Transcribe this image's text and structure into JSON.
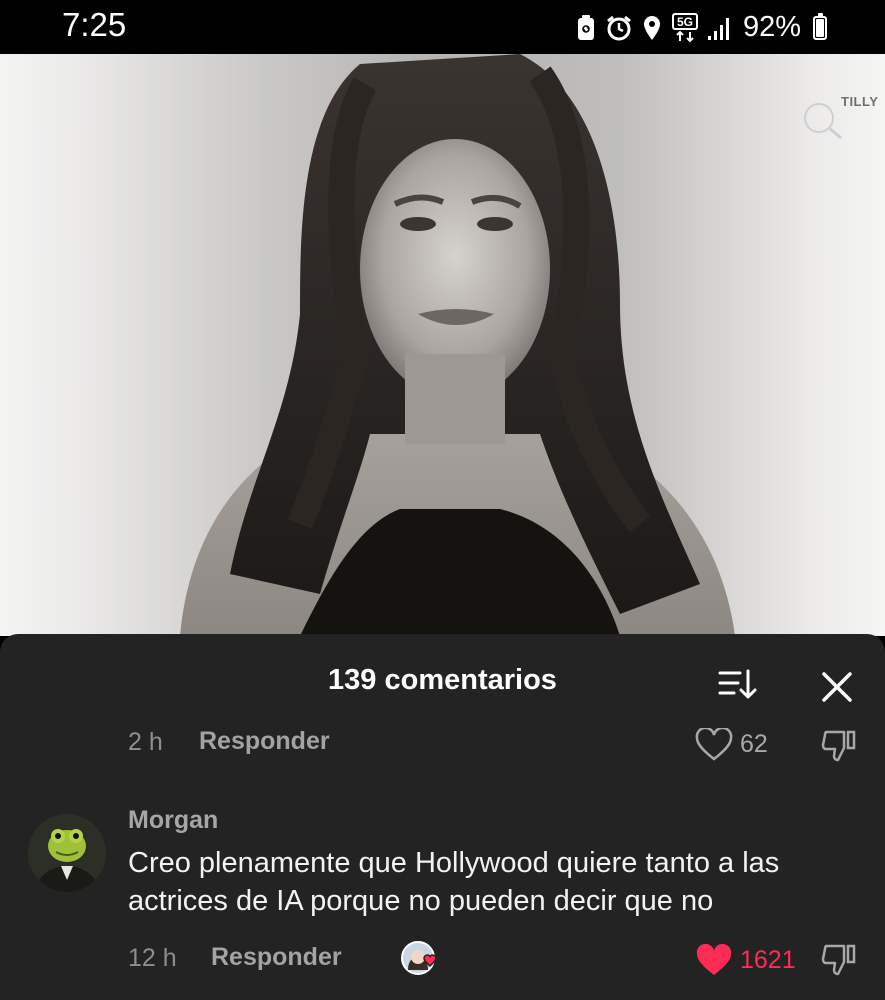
{
  "status_bar": {
    "time": "7:25",
    "network": "5G",
    "battery_percent": "92%",
    "icons": [
      "battery-saver-icon",
      "alarm-icon",
      "location-icon",
      "5g-data-icon",
      "signal-icon",
      "battery-icon"
    ]
  },
  "video": {
    "watermark": "TILLY",
    "description": "grayscale-portrait"
  },
  "comments_panel": {
    "title": "139 comentarios",
    "sort_icon": "sort-icon",
    "close_icon": "close-icon",
    "previous_comment": {
      "time": "2 h",
      "reply_label": "Responder",
      "likes": "62",
      "liked": false
    },
    "comment": {
      "author": "Morgan",
      "text": "Creo plenamente que Hollywood quiere tanto a las actrices de IA porque no pueden decir que no",
      "time": "12 h",
      "reply_label": "Responder",
      "likes": "1621",
      "liked": true,
      "creator_liked": true
    }
  },
  "colors": {
    "panel_bg": "#232323",
    "like_active": "#fe2c55",
    "muted_text": "#8e8e8e"
  }
}
